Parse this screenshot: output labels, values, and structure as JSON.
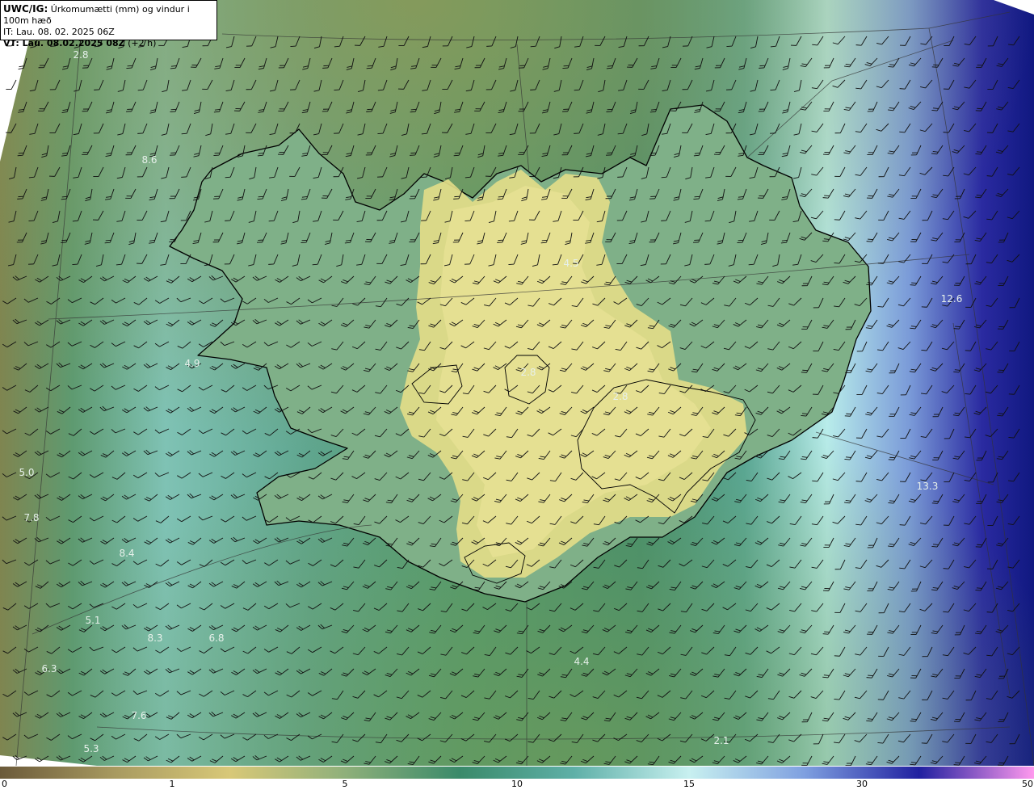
{
  "header": {
    "product": "UWC/IG:",
    "description": "Úrkomumætti (mm) og vindur i 100m hæð",
    "issue_time": "IT: Lau. 08. 02. 2025 06Z",
    "valid_label": "VT: Lau. 08.02.2025 08Z",
    "valid_offset": "(+2 h)"
  },
  "map_values": [
    "2.8",
    "8.6",
    "4.5",
    "12.6",
    "4.9",
    "2.8",
    "2.8",
    "5.0",
    "7.8",
    "8.4",
    "13.3",
    "5.1",
    "8.3",
    "6.8",
    "4.4",
    "6.3",
    "7.6",
    "5.3",
    "2.1"
  ],
  "colorbar": {
    "ticks": [
      "0",
      "1",
      "5",
      "10",
      "15",
      "30",
      "50"
    ],
    "colors": [
      "#6b5a3a",
      "#a89a60",
      "#d8c878",
      "#8fb07a",
      "#3a8a6a",
      "#5fb0a8",
      "#c8f0f0",
      "#7fa0e0",
      "#2020a0",
      "#ff99ee"
    ]
  },
  "colors": {
    "land_yellow": "#e3dd8a",
    "sea_teal": "#3d9080",
    "sea_light": "#bfeeed",
    "deep_blue": "#141a8a"
  }
}
